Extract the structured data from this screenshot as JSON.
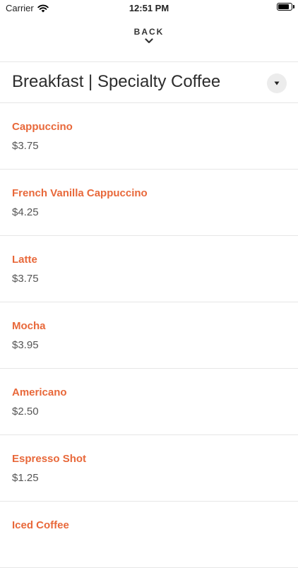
{
  "status_bar": {
    "carrier": "Carrier",
    "time": "12:51 PM",
    "battery_level": 0.9
  },
  "nav": {
    "back_label": "BACK"
  },
  "category": {
    "title": "Breakfast | Specialty Coffee"
  },
  "colors": {
    "accent": "#e8683a",
    "price": "#555555",
    "divider": "#e6e6e6"
  },
  "items": [
    {
      "name": "Cappuccino",
      "price": "$3.75"
    },
    {
      "name": "French Vanilla Cappuccino",
      "price": "$4.25"
    },
    {
      "name": "Latte",
      "price": "$3.75"
    },
    {
      "name": "Mocha",
      "price": "$3.95"
    },
    {
      "name": "Americano",
      "price": "$2.50"
    },
    {
      "name": "Espresso Shot",
      "price": "$1.25"
    },
    {
      "name": "Iced Coffee",
      "price": ""
    }
  ]
}
